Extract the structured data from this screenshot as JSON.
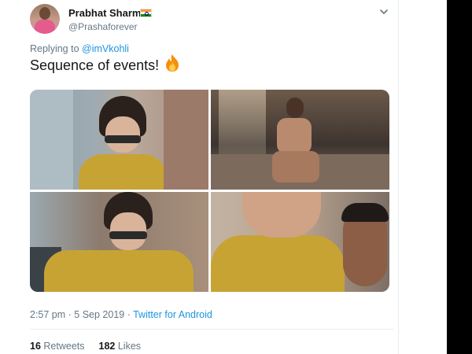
{
  "author": {
    "name": "Prabhat Sharma",
    "handle": "@Prashaforever",
    "flag_icon": "india-flag-icon"
  },
  "reply": {
    "prefix": "Replying to",
    "mention": "@imVkohli"
  },
  "tweet": {
    "text": "Sequence of events!",
    "emoji_icon": "fire-emoji-icon"
  },
  "media": {
    "photos": [
      {
        "name": "photo-woman-sunglasses"
      },
      {
        "name": "photo-man-shirtless-on-rock"
      },
      {
        "name": "photo-woman-sunglasses-pointing"
      },
      {
        "name": "photo-laughing-closeup"
      }
    ]
  },
  "meta": {
    "time_date": "2:57 pm · 5 Sep 2019 · ",
    "source": "Twitter for Android"
  },
  "stats": {
    "retweets_count": "16",
    "retweets_label": "Retweets",
    "likes_count": "182",
    "likes_label": "Likes"
  },
  "colors": {
    "link": "#1b95e0",
    "secondary_text": "#657786",
    "primary_text": "#14171a",
    "border": "#e6ecf0"
  }
}
